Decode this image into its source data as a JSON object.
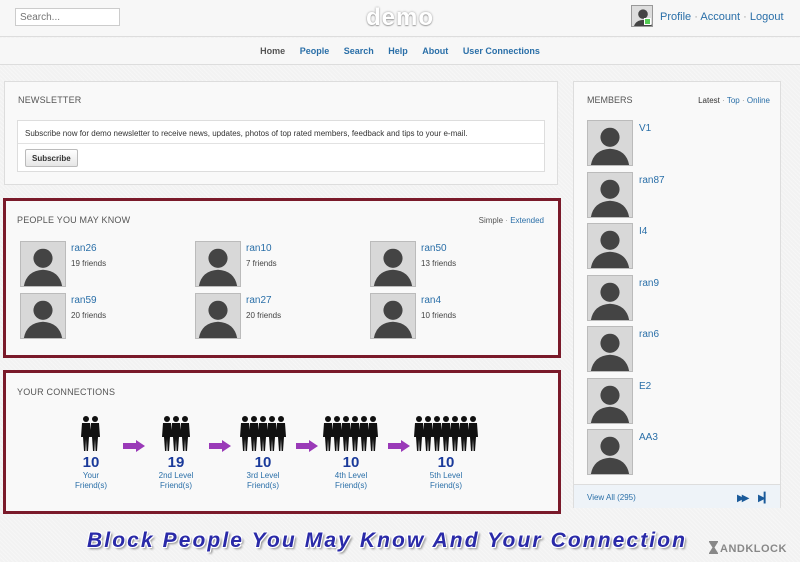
{
  "header": {
    "search_placeholder": "Search...",
    "logo": "demo",
    "links": [
      "Profile",
      "Account",
      "Logout"
    ]
  },
  "nav": {
    "items": [
      "Home",
      "People",
      "Search",
      "Help",
      "About",
      "User Connections"
    ]
  },
  "newsletter": {
    "title": "NEWSLETTER",
    "text": "Subscribe now for demo newsletter to receive news, updates, photos of top rated members, feedback and tips to your e-mail.",
    "button": "Subscribe"
  },
  "people_you_may_know": {
    "title": "PEOPLE YOU MAY KNOW",
    "view_simple": "Simple",
    "view_extended": "Extended",
    "people": [
      {
        "name": "ran26",
        "friends": "19 friends"
      },
      {
        "name": "ran10",
        "friends": "7 friends"
      },
      {
        "name": "ran50",
        "friends": "13 friends"
      },
      {
        "name": "ran59",
        "friends": "20 friends"
      },
      {
        "name": "ran27",
        "friends": "20 friends"
      },
      {
        "name": "ran4",
        "friends": "10 friends"
      }
    ]
  },
  "connections": {
    "title": "YOUR CONNECTIONS",
    "levels": [
      {
        "count": "10",
        "label1": "Your",
        "label2": "Friend(s)"
      },
      {
        "count": "19",
        "label1": "2nd Level",
        "label2": "Friend(s)"
      },
      {
        "count": "10",
        "label1": "3rd Level",
        "label2": "Friend(s)"
      },
      {
        "count": "10",
        "label1": "4th Level",
        "label2": "Friend(s)"
      },
      {
        "count": "10",
        "label1": "5th Level",
        "label2": "Friend(s)"
      }
    ]
  },
  "members": {
    "title": "MEMBERS",
    "tab_latest": "Latest",
    "tab_top": "Top",
    "tab_online": "Online",
    "list": [
      "V1",
      "ran87",
      "I4",
      "ran9",
      "ran6",
      "E2",
      "AA3"
    ],
    "view_all": "View All (295)",
    "next_icon": "▶▶",
    "last_icon": "▶▎"
  },
  "caption": "Block People You May Know And Your Connection",
  "watermark": "ANDKLOCK",
  "colors": {
    "highlight_border": "#7a1a2a",
    "link": "#2a6fa8",
    "caption": "#2a2aa8"
  }
}
